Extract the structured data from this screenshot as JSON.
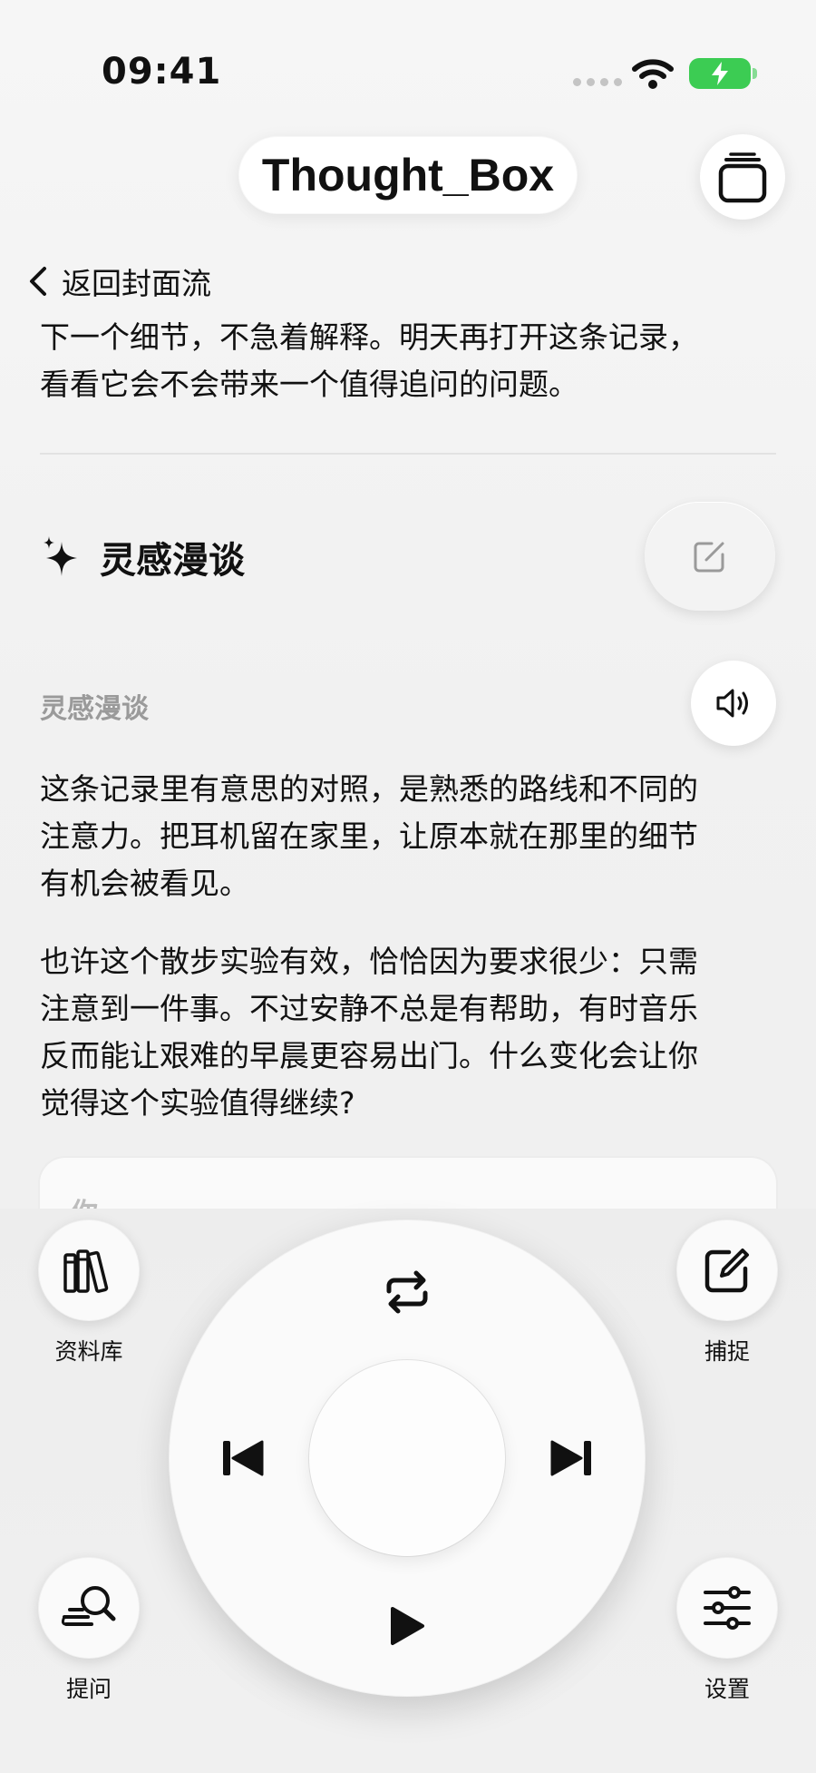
{
  "status_bar": {
    "time": "09:41"
  },
  "header": {
    "title": "Thought_Box"
  },
  "back": {
    "label": "返回封面流"
  },
  "entry": {
    "text_lines": [
      "下一个细节，不急着解释。明天再打开这条记录，",
      "看看它会不会带来一个值得追问的问题。"
    ]
  },
  "inspiration": {
    "section_title": "灵感漫谈",
    "sub_label": "灵感漫谈",
    "paragraph1_lines": [
      "这条记录里有意思的对照，是熟悉的路线和不同的",
      "注意力。把耳机留在家里，让原本就在那里的细节",
      "有机会被看见。"
    ],
    "paragraph2_lines": [
      "也许这个散步实验有效，恰恰因为要求很少：只需",
      "注意到一件事。不过安静不总是有帮助，有时音乐",
      "反而能让艰难的早晨更容易出门。什么变化会让你",
      "觉得这个实验值得继续?"
    ]
  },
  "reply_card": {
    "label": "你"
  },
  "bottom_nav": {
    "library": "资料库",
    "capture": "捕捉",
    "ask": "提问",
    "settings": "设置"
  },
  "colors": {
    "battery": "#3ccc53",
    "accent": "#111111",
    "muted": "#9a9a9a"
  },
  "icons": [
    "wifi-icon",
    "battery-icon",
    "cards-stack-icon",
    "chevron-left-icon",
    "sparkles-icon",
    "edit-icon",
    "speaker-icon",
    "books-icon",
    "compose-icon",
    "ask-search-icon",
    "sliders-icon",
    "repeat-icon",
    "previous-icon",
    "next-icon",
    "play-icon"
  ]
}
